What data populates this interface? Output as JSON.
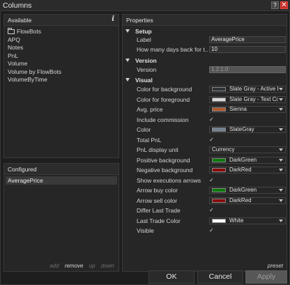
{
  "window": {
    "title": "Columns",
    "help_label": "?",
    "close_label": "✕"
  },
  "available": {
    "header": "Available",
    "info_label": "i",
    "items": [
      "FlowBots",
      "APQ",
      "Notes",
      "PnL",
      "Volume",
      "Volume by FlowBots",
      "VolumeByTime"
    ]
  },
  "configured": {
    "header": "Configured",
    "items": [
      "AveragePrice"
    ],
    "actions": [
      "add",
      "remove",
      "up",
      "down"
    ]
  },
  "properties": {
    "header": "Properties",
    "setup": {
      "title": "Setup",
      "label_name": "Label",
      "label_value": "AveragePrice",
      "days_name": "How many days back for t...",
      "days_value": "10"
    },
    "version": {
      "title": "Version",
      "version_name": "Version",
      "version_value": "1.2.1.0"
    },
    "visual": {
      "title": "Visual",
      "rows": [
        {
          "name": "Color for background",
          "type": "color",
          "value": "Slate Gray - Active Ba",
          "color": "#2f3338"
        },
        {
          "name": "Color for foreground",
          "type": "color",
          "value": "Slate Gray - Text Colo",
          "color": "#d8d8d8"
        },
        {
          "name": "Avg. price",
          "type": "color",
          "value": "Sienna",
          "color": "#b0582c"
        },
        {
          "name": "Include commission",
          "type": "check",
          "value": "✓"
        },
        {
          "name": "Color",
          "type": "color",
          "value": "SlateGray",
          "color": "#708090"
        },
        {
          "name": "Total PnL",
          "type": "check",
          "value": "✓"
        },
        {
          "name": "PnL display unit",
          "type": "select",
          "value": "Currency"
        },
        {
          "name": "Positive background",
          "type": "color",
          "value": "DarkGreen",
          "color": "#0a7a0a"
        },
        {
          "name": "Negative background",
          "type": "color",
          "value": "DarkRed",
          "color": "#8b0a0a"
        },
        {
          "name": "Show executions arrows",
          "type": "check",
          "value": "✓"
        },
        {
          "name": "Arrow buy color",
          "type": "color",
          "value": "DarkGreen",
          "color": "#0a7a0a"
        },
        {
          "name": "Arrow sell color",
          "type": "color",
          "value": "DarkRed",
          "color": "#8b0a0a"
        },
        {
          "name": "Differ Last Trade",
          "type": "check",
          "value": "✓"
        },
        {
          "name": "Last Trade Color",
          "type": "color",
          "value": "White",
          "color": "#ffffff"
        },
        {
          "name": "Visible",
          "type": "check",
          "value": "✓"
        }
      ]
    },
    "preset_label": "preset"
  },
  "buttons": {
    "ok": "OK",
    "cancel": "Cancel",
    "apply": "Apply"
  }
}
